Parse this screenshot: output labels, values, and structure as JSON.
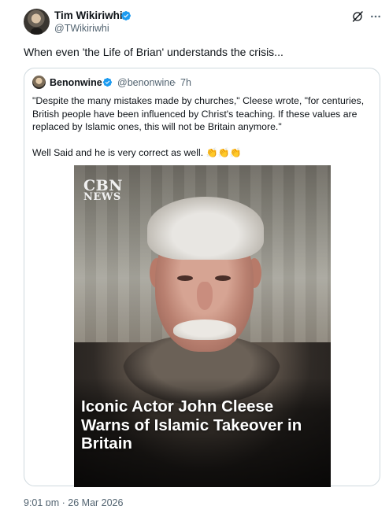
{
  "tweet": {
    "author_name": "Tim Wikiriwhi",
    "author_handle": "@TWikiriwhi",
    "text": "When even 'the Life of Brian' understands the crisis...",
    "timestamp": "9:01 pm · 26 Mar 2026"
  },
  "quoted": {
    "author_name": "Benonwine",
    "author_handle": "@benonwine",
    "separator": "·",
    "time": "7h",
    "body_lines": [
      "\"Despite the many mistakes made by churches,\" Cleese wrote, \"for centuries,",
      "British people have been influenced by Christ's teaching. If these values are",
      "replaced by Islamic ones, this will not be Britain anymore.\""
    ],
    "body_line2": "Well Said and he is very correct as well.",
    "emoji": [
      "👏",
      "👏",
      "👏"
    ],
    "media": {
      "logo_line1": "CBN",
      "logo_line2": "NEWS",
      "headline_lines": [
        "Iconic Actor John Cleese",
        "Warns of Islamic Takeover in",
        "Britain"
      ]
    }
  },
  "colors": {
    "verified": "#1d9bf0",
    "secondary_text": "#536471",
    "border": "#cfd9de"
  },
  "icons": [
    "verified-badge-icon",
    "grok-icon",
    "more-options-icon"
  ]
}
